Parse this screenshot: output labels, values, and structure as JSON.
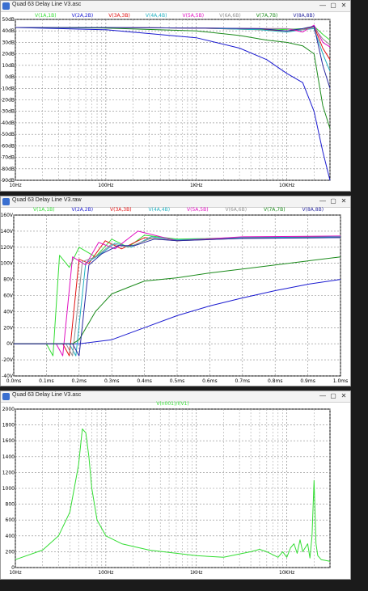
{
  "windows": [
    {
      "title": "Quad 63 Delay Line V3.asc",
      "buttons": {
        "minimize": "—",
        "maximize": "▢",
        "close": "✕"
      },
      "chart_data": {
        "type": "line",
        "scale": "log-x",
        "xlim": [
          10,
          30000
        ],
        "ylim": [
          -90,
          50
        ],
        "x_ticks": [
          {
            "v": 10,
            "label": "10Hz"
          },
          {
            "v": 100,
            "label": "100Hz"
          },
          {
            "v": 1000,
            "label": "1KHz"
          },
          {
            "v": 10000,
            "label": "10KHz"
          }
        ],
        "y_ticks": [
          {
            "v": 50,
            "label": "50dB"
          },
          {
            "v": 40,
            "label": "40dB"
          },
          {
            "v": 30,
            "label": "30dB"
          },
          {
            "v": 20,
            "label": "20dB"
          },
          {
            "v": 10,
            "label": "10dB"
          },
          {
            "v": 0,
            "label": "0dB"
          },
          {
            "v": -10,
            "label": "-10dB"
          },
          {
            "v": -20,
            "label": "-20dB"
          },
          {
            "v": -30,
            "label": "-30dB"
          },
          {
            "v": -40,
            "label": "-40dB"
          },
          {
            "v": -50,
            "label": "-50dB"
          },
          {
            "v": -60,
            "label": "-60dB"
          },
          {
            "v": -70,
            "label": "-70dB"
          },
          {
            "v": -80,
            "label": "-80dB"
          },
          {
            "v": -90,
            "label": "-90dB"
          }
        ],
        "grid": true,
        "series": [
          {
            "name": "V(1A,1B)",
            "color": "#33dd33",
            "x": [
              10,
              100,
              1000,
              3000,
              8000,
              15000,
              20000,
              25000,
              30000
            ],
            "y": [
              43,
              43,
              42.5,
              42,
              41,
              42,
              44,
              37,
              32
            ]
          },
          {
            "name": "V(2A,2B)",
            "color": "#1a1ad0",
            "x": [
              10,
              100,
              1000,
              3000,
              6000,
              10000,
              15000,
              20000,
              25000,
              30000
            ],
            "y": [
              43,
              41,
              34,
              25,
              15,
              3,
              -5,
              -30,
              -65,
              -90
            ]
          },
          {
            "name": "V(3A,3B)",
            "color": "#e01010",
            "x": [
              10,
              100,
              1000,
              5000,
              10000,
              15000,
              20000,
              25000,
              30000
            ],
            "y": [
              43,
              43,
              42.5,
              41,
              40,
              41,
              44,
              25,
              15
            ]
          },
          {
            "name": "V(4A,4B)",
            "color": "#20b0c0",
            "x": [
              10,
              100,
              1000,
              5000,
              10000,
              15000,
              20000,
              25000,
              30000
            ],
            "y": [
              43,
              43,
              42.5,
              41,
              39,
              41,
              42,
              20,
              5
            ]
          },
          {
            "name": "V(5A,5B)",
            "color": "#e010c0",
            "x": [
              10,
              100,
              1000,
              5000,
              10000,
              15000,
              20000,
              25000,
              30000
            ],
            "y": [
              43,
              43,
              42.5,
              42,
              42,
              39,
              45,
              30,
              26
            ]
          },
          {
            "name": "V(6A,6B)",
            "color": "#909090",
            "x": [
              10,
              100,
              1000,
              5000,
              10000,
              15000,
              20000,
              25000,
              30000
            ],
            "y": [
              43,
              43,
              42.5,
              42,
              42,
              41,
              43,
              33,
              28
            ]
          },
          {
            "name": "V(7A,7B)",
            "color": "#1a8a1a",
            "x": [
              10,
              100,
              1000,
              3000,
              6000,
              10000,
              15000,
              20000,
              25000,
              30000
            ],
            "y": [
              43,
              42.5,
              40,
              36,
              32,
              30,
              27,
              20,
              -25,
              -45
            ]
          },
          {
            "name": "V(8A,8B)",
            "color": "#2a2aa0",
            "x": [
              10,
              100,
              1000,
              5000,
              10000,
              15000,
              20000,
              25000,
              30000
            ],
            "y": [
              43,
              43,
              42.5,
              42,
              40,
              42,
              44,
              10,
              -10
            ]
          }
        ]
      }
    },
    {
      "title": "Quad 63 Delay Line V3.raw",
      "buttons": {
        "minimize": "—",
        "maximize": "▢",
        "close": "✕"
      },
      "chart_data": {
        "type": "line",
        "scale": "linear",
        "xlim": [
          0,
          1.0
        ],
        "ylim": [
          -40,
          160
        ],
        "x_ticks": [
          {
            "v": 0,
            "label": "0.0ms"
          },
          {
            "v": 0.1,
            "label": "0.1ms"
          },
          {
            "v": 0.2,
            "label": "0.2ms"
          },
          {
            "v": 0.3,
            "label": "0.3ms"
          },
          {
            "v": 0.4,
            "label": "0.4ms"
          },
          {
            "v": 0.5,
            "label": "0.5ms"
          },
          {
            "v": 0.6,
            "label": "0.6ms"
          },
          {
            "v": 0.7,
            "label": "0.7ms"
          },
          {
            "v": 0.8,
            "label": "0.8ms"
          },
          {
            "v": 0.9,
            "label": "0.9ms"
          },
          {
            "v": 1.0,
            "label": "1.0ms"
          }
        ],
        "y_ticks": [
          {
            "v": 160,
            "label": "160V"
          },
          {
            "v": 140,
            "label": "140V"
          },
          {
            "v": 120,
            "label": "120V"
          },
          {
            "v": 100,
            "label": "100V"
          },
          {
            "v": 80,
            "label": "80V"
          },
          {
            "v": 60,
            "label": "60V"
          },
          {
            "v": 40,
            "label": "40V"
          },
          {
            "v": 20,
            "label": "20V"
          },
          {
            "v": 0,
            "label": "0V"
          },
          {
            "v": -20,
            "label": "-20V"
          },
          {
            "v": -40,
            "label": "-40V"
          }
        ],
        "grid": true,
        "series": [
          {
            "name": "V(1A,1B)",
            "color": "#33dd33",
            "x": [
              0,
              0.1,
              0.12,
              0.14,
              0.17,
              0.2,
              0.25,
              0.3,
              0.35,
              0.4,
              0.5,
              0.7,
              1.0
            ],
            "y": [
              0,
              0,
              -15,
              110,
              95,
              120,
              108,
              130,
              120,
              135,
              130,
              132,
              133
            ]
          },
          {
            "name": "V(2A,2B)",
            "color": "#1a1ad0",
            "x": [
              0,
              0.2,
              0.3,
              0.4,
              0.5,
              0.6,
              0.7,
              0.8,
              0.9,
              1.0
            ],
            "y": [
              0,
              0,
              5,
              20,
              35,
              47,
              57,
              66,
              74,
              80
            ]
          },
          {
            "name": "V(3A,3B)",
            "color": "#e01010",
            "x": [
              0,
              0.15,
              0.17,
              0.2,
              0.23,
              0.28,
              0.33,
              0.4,
              0.5,
              0.7,
              1.0
            ],
            "y": [
              0,
              0,
              -15,
              105,
              100,
              128,
              118,
              132,
              128,
              132,
              133
            ]
          },
          {
            "name": "V(4A,4B)",
            "color": "#20b0c0",
            "x": [
              0,
              0.17,
              0.19,
              0.22,
              0.26,
              0.31,
              0.36,
              0.42,
              0.5,
              0.7,
              1.0
            ],
            "y": [
              0,
              0,
              -15,
              100,
              110,
              125,
              120,
              133,
              129,
              132,
              133
            ]
          },
          {
            "name": "V(5A,5B)",
            "color": "#e010c0",
            "x": [
              0,
              0.13,
              0.15,
              0.18,
              0.22,
              0.26,
              0.31,
              0.38,
              0.5,
              0.7,
              1.0
            ],
            "y": [
              0,
              0,
              -15,
              108,
              98,
              126,
              118,
              140,
              128,
              133,
              134
            ]
          },
          {
            "name": "V(6A,6B)",
            "color": "#909090",
            "x": [
              0,
              0.16,
              0.18,
              0.21,
              0.25,
              0.3,
              0.35,
              0.42,
              0.5,
              0.7,
              1.0
            ],
            "y": [
              0,
              0,
              -15,
              102,
              108,
              124,
              120,
              131,
              128,
              131,
              132
            ]
          },
          {
            "name": "V(7A,7B)",
            "color": "#1a8a1a",
            "x": [
              0,
              0.18,
              0.2,
              0.25,
              0.3,
              0.35,
              0.4,
              0.5,
              0.6,
              0.7,
              0.8,
              0.9,
              1.0
            ],
            "y": [
              0,
              0,
              5,
              40,
              62,
              70,
              78,
              82,
              88,
              93,
              98,
              103,
              108
            ]
          },
          {
            "name": "V(8A,8B)",
            "color": "#2a2aa0",
            "x": [
              0,
              0.18,
              0.2,
              0.23,
              0.27,
              0.32,
              0.37,
              0.43,
              0.5,
              0.7,
              1.0
            ],
            "y": [
              0,
              0,
              -15,
              98,
              112,
              122,
              122,
              130,
              128,
              131,
              132
            ]
          }
        ]
      }
    },
    {
      "title": "Quad 63 Delay Line V3.asc",
      "buttons": {
        "minimize": "—",
        "maximize": "▢",
        "close": "✕"
      },
      "chart_data": {
        "type": "line",
        "scale": "log-x",
        "xlim": [
          10,
          30000
        ],
        "ylim": [
          0,
          2000
        ],
        "x_ticks": [
          {
            "v": 10,
            "label": "10Hz"
          },
          {
            "v": 100,
            "label": "100Hz"
          },
          {
            "v": 1000,
            "label": "1KHz"
          },
          {
            "v": 10000,
            "label": "10KHz"
          }
        ],
        "y_ticks": [
          {
            "v": 2000,
            "label": "2000"
          },
          {
            "v": 1800,
            "label": "1800"
          },
          {
            "v": 1600,
            "label": "1600"
          },
          {
            "v": 1400,
            "label": "1400"
          },
          {
            "v": 1200,
            "label": "1200"
          },
          {
            "v": 1000,
            "label": "1000"
          },
          {
            "v": 800,
            "label": "800"
          },
          {
            "v": 600,
            "label": "600"
          },
          {
            "v": 400,
            "label": "400"
          },
          {
            "v": 200,
            "label": "200"
          },
          {
            "v": 0,
            "label": "0"
          }
        ],
        "grid": true,
        "series": [
          {
            "name": "V(n001)/I(V1)",
            "color": "#33dd33",
            "x": [
              10,
              20,
              30,
              40,
              50,
              55,
              60,
              65,
              70,
              80,
              100,
              150,
              300,
              1000,
              2000,
              4000,
              5000,
              6000,
              8000,
              9000,
              10000,
              11000,
              12000,
              13000,
              14000,
              15000,
              17000,
              18000,
              19000,
              20000,
              21000,
              22000,
              24000,
              30000
            ],
            "y": [
              100,
              220,
              400,
              700,
              1300,
              1750,
              1700,
              1400,
              1000,
              600,
              400,
              300,
              220,
              150,
              130,
              200,
              230,
              200,
              130,
              200,
              130,
              250,
              300,
              180,
              350,
              200,
              300,
              120,
              400,
              1100,
              300,
              150,
              100,
              80
            ]
          }
        ]
      }
    }
  ]
}
